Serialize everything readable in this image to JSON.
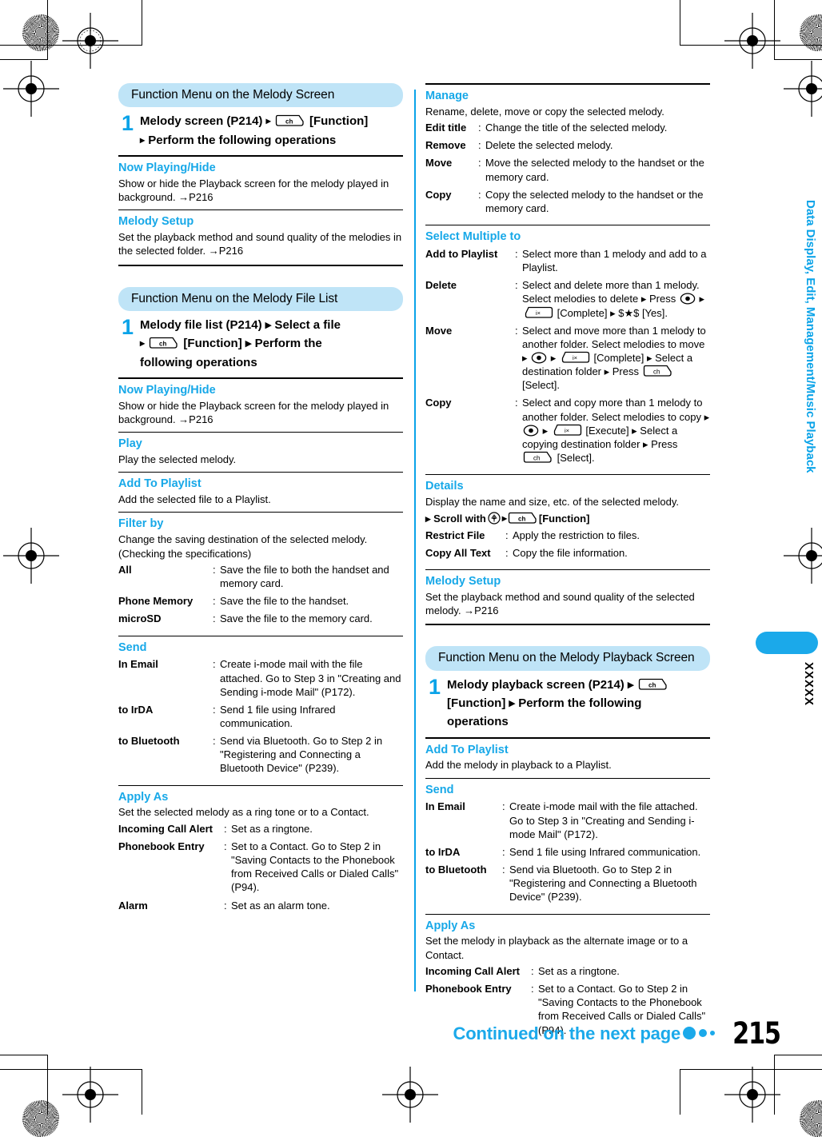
{
  "sidebar": {
    "tab_text": "Data Display, Edit, Management/Music Playback",
    "tab_code": "XXXXX"
  },
  "footer": {
    "continued": "Continued on the next page",
    "page_number": "215"
  },
  "colors": {
    "accent": "#17a8e8",
    "pill_bg": "#bfe4f7",
    "divider": "#0aa3e8"
  },
  "left_column": {
    "blocks": [
      {
        "pill": "Function Menu on the Melody Screen",
        "step": {
          "number": "1",
          "line1_a": "Melody screen (P214)",
          "line1_key": "ch-key-icon",
          "line1_b": "[Function]",
          "line2": "Perform the following operations"
        },
        "sections": [
          {
            "title": "Now Playing/Hide",
            "desc": "Show or hide the Playback screen for the melody played in background. →P216"
          },
          {
            "title": "Melody Setup",
            "desc": "Set the playback method and sound quality of the melodies in the selected folder. →P216"
          }
        ]
      },
      {
        "pill": "Function Menu on the Melody File List",
        "step": {
          "number": "1",
          "line1": "Melody file list (P214) ▸ Select a file",
          "line2_key": "ch-key-icon",
          "line2": "[Function] ▸ Perform the",
          "line3": "following operations"
        },
        "sections": [
          {
            "title": "Now Playing/Hide",
            "desc": "Show or hide the Playback screen for the melody played in background. →P216"
          },
          {
            "title": "Play",
            "desc": "Play the selected melody."
          },
          {
            "title": "Add To Playlist",
            "desc": "Add the selected file to a Playlist."
          },
          {
            "title": "Filter by",
            "desc": "Change the saving destination of the selected melody. (Checking the specifications)",
            "defs": [
              {
                "term": "All",
                "sep": ":",
                "def": "Save the file to both the handset and memory card."
              },
              {
                "term": "Phone Memory",
                "sep": ":",
                "def": "Save the file to the handset."
              },
              {
                "term": "microSD",
                "sep": ":",
                "def": "Save the file to the memory card."
              }
            ]
          },
          {
            "title": "Send",
            "desc": "",
            "defs": [
              {
                "term": "In Email",
                "sep": ":",
                "def": "Create i-mode mail with the file attached. Go to Step 3 in \"Creating and Sending i-mode Mail\" (P172)."
              },
              {
                "term": "to IrDA",
                "sep": ":",
                "def": "Send 1 file using Infrared communication."
              },
              {
                "term": "to Bluetooth",
                "sep": ":",
                "def": "Send via Bluetooth. Go to Step 2 in \"Registering and Connecting a Bluetooth Device\" (P239)."
              }
            ]
          },
          {
            "title": "Apply As",
            "desc": "Set the selected melody as a ring tone or to a Contact.",
            "defs": [
              {
                "term": "Incoming Call Alert",
                "sep": ":",
                "def": "Set as a ringtone."
              },
              {
                "term": "Phonebook Entry",
                "sep": ":",
                "def": "Set to a Contact. Go to Step 2 in \"Saving Contacts to the Phonebook from Received Calls or Dialed Calls\" (P94)."
              },
              {
                "term": "Alarm",
                "sep": ":",
                "def": "Set as an alarm tone."
              }
            ]
          }
        ]
      }
    ]
  },
  "right_column": {
    "sections_top": [
      {
        "title": "Manage",
        "desc": "Rename, delete, move or copy the selected melody.",
        "defs": [
          {
            "term": "Edit title",
            "sep": ":",
            "def": "Change the title of the selected melody."
          },
          {
            "term": "Remove",
            "sep": ":",
            "def": "Delete the selected melody."
          },
          {
            "term": "Move",
            "sep": ":",
            "def": "Move the selected melody to the handset or the memory card."
          },
          {
            "term": "Copy",
            "sep": ":",
            "def": "Copy the selected melody to the handset or the memory card."
          }
        ]
      },
      {
        "title": "Select Multiple to",
        "desc": "",
        "defs": [
          {
            "term": "Add to Playlist",
            "sep": ":",
            "def": "Select more than 1 melody and add to a Playlist."
          },
          {
            "term": "Delete",
            "sep": ":",
            "def_parts": [
              "Select and delete more than 1 melody. Select melodies to delete ▸ Press ",
              "center-key-icon",
              " ▸ ",
              "imode-key-icon",
              " [Complete] ▸ $★$ [Yes]."
            ]
          },
          {
            "term": "Move",
            "sep": ":",
            "def_parts": [
              "Select and move more than 1 melody to another folder. Select melodies to move ▸ ",
              "center-key-icon",
              " ▸ ",
              "imode-key-icon",
              " [Complete] ▸ Select a destination folder ▸ Press ",
              "ch-key-icon",
              " [Select]."
            ]
          },
          {
            "term": "Copy",
            "sep": ":",
            "def_parts": [
              "Select and copy more than 1 melody to another folder. Select melodies to copy ▸ ",
              "center-key-icon",
              " ▸ ",
              "imode-key-icon",
              " [Execute] ▸ Select a copying destination folder ▸ Press ",
              "ch-key-icon",
              " [Select]."
            ]
          }
        ]
      },
      {
        "title": "Details",
        "desc": "Display the name and size, etc. of the selected melody.",
        "scroll_line": "▸ Scroll with",
        "scroll_suffix": "[Function]",
        "defs": [
          {
            "term": "Restrict File",
            "sep": ":",
            "def": "Apply the restriction to files."
          },
          {
            "term": "Copy All Text",
            "sep": ":",
            "def": "Copy the file information."
          }
        ]
      },
      {
        "title": "Melody Setup",
        "desc": "Set the playback method and sound quality of the selected melody. →P216"
      }
    ],
    "block": {
      "pill": "Function Menu on the Melody Playback Screen",
      "step": {
        "number": "1",
        "line1": "Melody playback screen (P214) ▸",
        "line2": "[Function] ▸ Perform the following",
        "line3": "operations"
      },
      "sections": [
        {
          "title": "Add To Playlist",
          "desc": "Add the melody in playback to a Playlist."
        },
        {
          "title": "Send",
          "desc": "",
          "defs": [
            {
              "term": "In Email",
              "sep": ":",
              "def": "Create i-mode mail with the file attached. Go to Step 3 in \"Creating and Sending i-mode Mail\" (P172)."
            },
            {
              "term": "to IrDA",
              "sep": ":",
              "def": "Send 1 file using Infrared communication."
            },
            {
              "term": "to Bluetooth",
              "sep": ":",
              "def": "Send via Bluetooth. Go to Step 2 in \"Registering and Connecting a Bluetooth Device\" (P239)."
            }
          ]
        },
        {
          "title": "Apply As",
          "desc": "Set the melody in playback as the alternate image or to a Contact.",
          "defs": [
            {
              "term": "Incoming Call Alert",
              "sep": ":",
              "def": "Set as a ringtone."
            },
            {
              "term": "Phonebook Entry",
              "sep": ":",
              "def": "Set to a Contact. Go to Step 2 in \"Saving Contacts to the Phonebook from Received Calls or Dialed Calls\" (P94)."
            }
          ]
        }
      ]
    }
  }
}
